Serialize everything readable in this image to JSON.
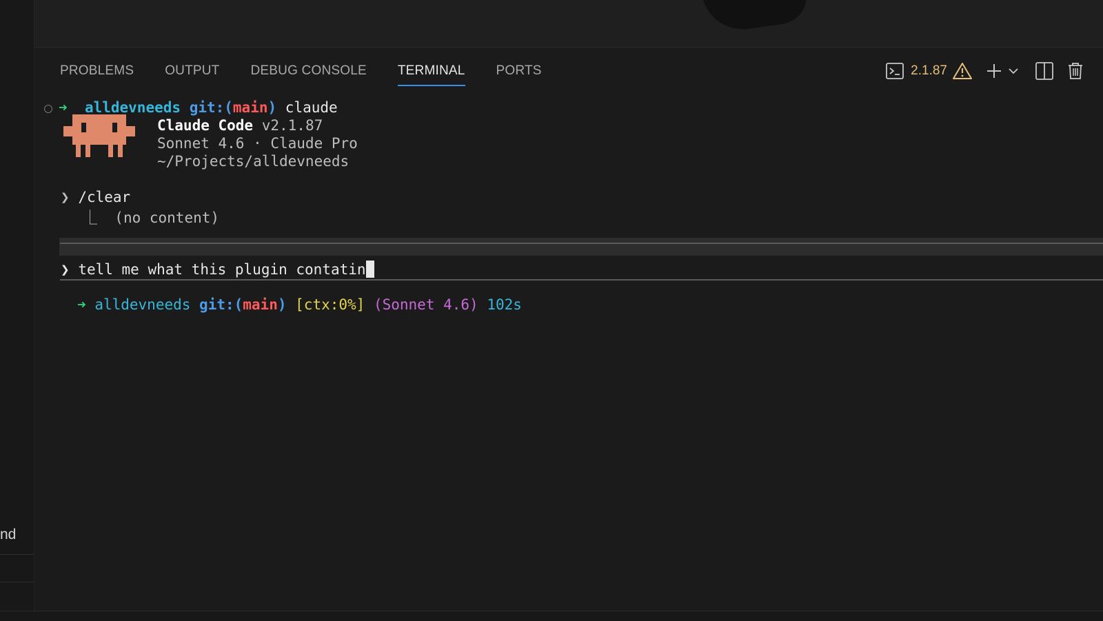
{
  "left_sidebar": {
    "partial_text": "nd"
  },
  "panel": {
    "tabs": [
      {
        "label": "PROBLEMS",
        "active": false
      },
      {
        "label": "OUTPUT",
        "active": false
      },
      {
        "label": "DEBUG CONSOLE",
        "active": false
      },
      {
        "label": "TERMINAL",
        "active": true
      },
      {
        "label": "PORTS",
        "active": false
      }
    ],
    "toolbar": {
      "terminal_version": "2.1.87"
    }
  },
  "terminal": {
    "prompt1": {
      "arrow": "➜",
      "dir": "alldevneeds",
      "git_prefix": "git:(",
      "branch": "main",
      "git_suffix": ")",
      "command": "claude"
    },
    "banner": {
      "product": "Claude Code",
      "version": "v2.1.87",
      "model_plan": "Sonnet 4.6 · Claude Pro",
      "path": "~/Projects/alldevneeds"
    },
    "history": {
      "chevron": "❯",
      "command": "/clear",
      "result_branch": "⎿",
      "result": "(no content)"
    },
    "input": {
      "chevron": "❯",
      "text": "tell me what this plugin contatin"
    },
    "status": {
      "arrow": "➜",
      "dir": "alldevneeds",
      "git_prefix": "git:(",
      "branch": "main",
      "git_suffix": ")",
      "ctx": "[ctx:0%]",
      "model": "(Sonnet 4.6)",
      "elapsed": "102s"
    }
  },
  "colors": {
    "accent_tab": "#3b8eea",
    "mascot": "#e0886a",
    "warning": "#e5c07b"
  },
  "icons": [
    "terminal-icon",
    "warning-icon",
    "plus-icon",
    "chevron-down-icon",
    "split-icon",
    "trash-icon",
    "claude-mascot-icon"
  ]
}
